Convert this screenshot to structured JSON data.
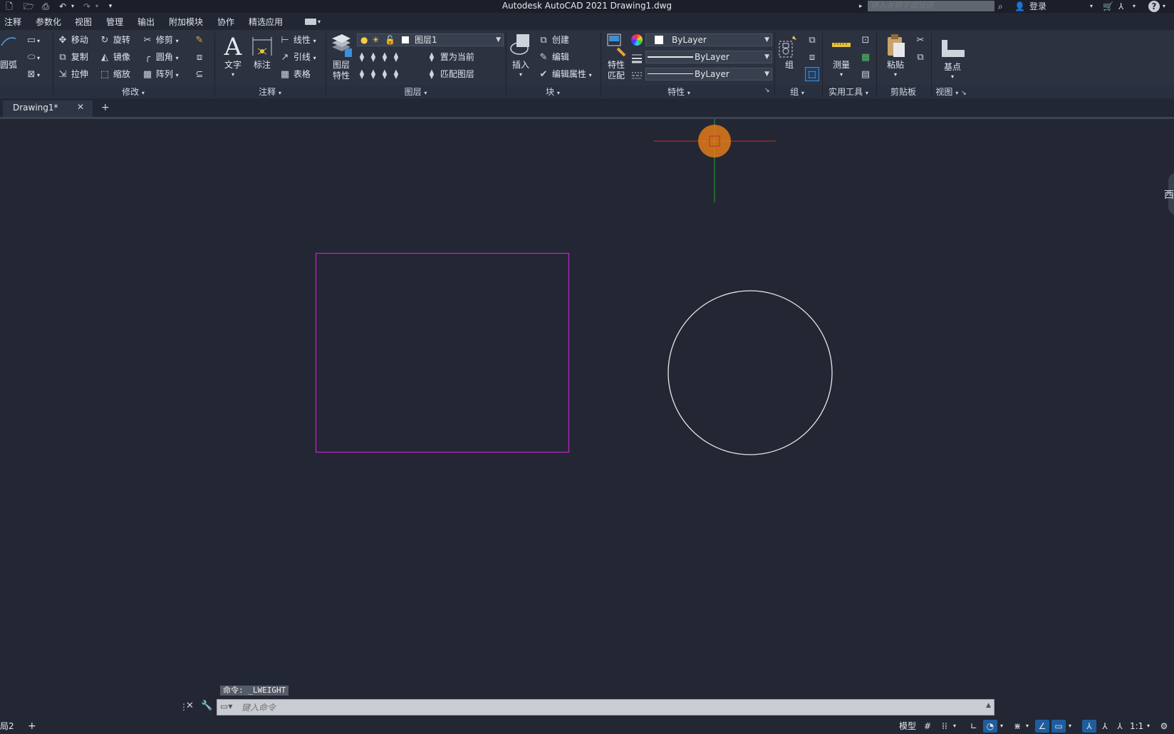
{
  "titlebar": {
    "app_title": "Autodesk AutoCAD 2021    Drawing1.dwg",
    "search_placeholder": "键入关键字或短语",
    "login": "登录"
  },
  "menu": [
    "注释",
    "参数化",
    "视图",
    "管理",
    "输出",
    "附加模块",
    "协作",
    "精选应用"
  ],
  "ribbon": {
    "draw": {
      "arc_label": "圆弧"
    },
    "modify": {
      "title": "修改",
      "move": "移动",
      "rotate": "旋转",
      "trim": "修剪",
      "copy": "复制",
      "mirror": "镜像",
      "fillet": "圆角",
      "stretch": "拉伸",
      "scale": "缩放",
      "array": "阵列"
    },
    "annotation": {
      "title": "注释",
      "text": "文字",
      "dimension": "标注",
      "linear": "线性",
      "leader": "引线",
      "table": "表格"
    },
    "layers": {
      "title": "图层",
      "layer_props_1": "图层",
      "layer_props_2": "特性",
      "current_layer": "图层1",
      "set_current": "置为当前",
      "match_layer": "匹配图层"
    },
    "block": {
      "title": "块",
      "insert": "插入",
      "create": "创建",
      "edit": "编辑",
      "edit_attr": "编辑属性"
    },
    "properties": {
      "title": "特性",
      "match_1": "特性",
      "match_2": "匹配",
      "color": "ByLayer",
      "lineweight": "ByLayer",
      "linetype": "ByLayer"
    },
    "groups": {
      "title": "组",
      "group": "组"
    },
    "utilities": {
      "title": "实用工具",
      "measure": "测量"
    },
    "clipboard": {
      "title": "剪贴板",
      "paste": "粘贴"
    },
    "view": {
      "title": "视图",
      "basepoint": "基点"
    }
  },
  "tabs": {
    "doc": "Drawing1*",
    "close": "✕",
    "add": "+"
  },
  "viewcube": {
    "west": "西"
  },
  "command": {
    "history": "命令: _LWEIGHT",
    "placeholder": "键入命令"
  },
  "statusbar": {
    "layout_tab": "局2",
    "model": "模型",
    "scale": "1:1"
  },
  "colors": {
    "background": "#222733",
    "rectangle": "#c21fc4",
    "circle": "#e8e8e8",
    "x_axis": "#cc2a2a",
    "y_axis": "#22a330",
    "ucs_marker": "#e07a1a"
  }
}
